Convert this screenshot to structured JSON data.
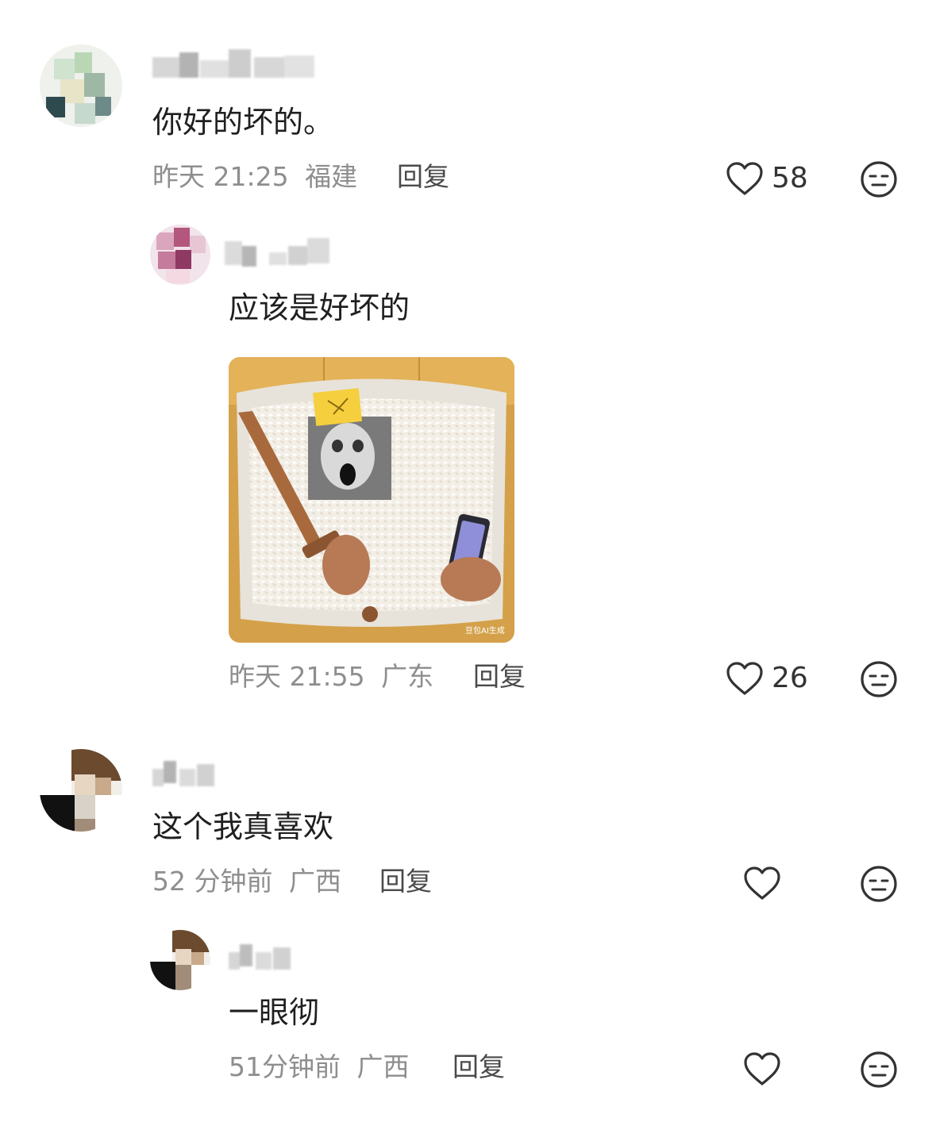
{
  "comments": [
    {
      "text": "你好的坏的。",
      "time": "昨天 21:25",
      "location": "福建",
      "reply_label": "回复",
      "likes": "58"
    },
    {
      "text": "应该是好坏的",
      "time": "昨天 21:55",
      "location": "广东",
      "reply_label": "回复",
      "likes": "26",
      "image_watermark": "豆包AI生成"
    },
    {
      "text": "这个我真喜欢",
      "time": "52 分钟前",
      "location": "广西",
      "reply_label": "回复",
      "likes": ""
    },
    {
      "text": "一眼彻",
      "time": "51分钟前",
      "location": "广西",
      "reply_label": "回复",
      "likes": ""
    }
  ],
  "colors": {
    "meta": "#8e8e8e",
    "text": "#1f1f1f",
    "icon": "#333333"
  },
  "icons": [
    "heart-outline-icon",
    "dislike-face-icon"
  ]
}
